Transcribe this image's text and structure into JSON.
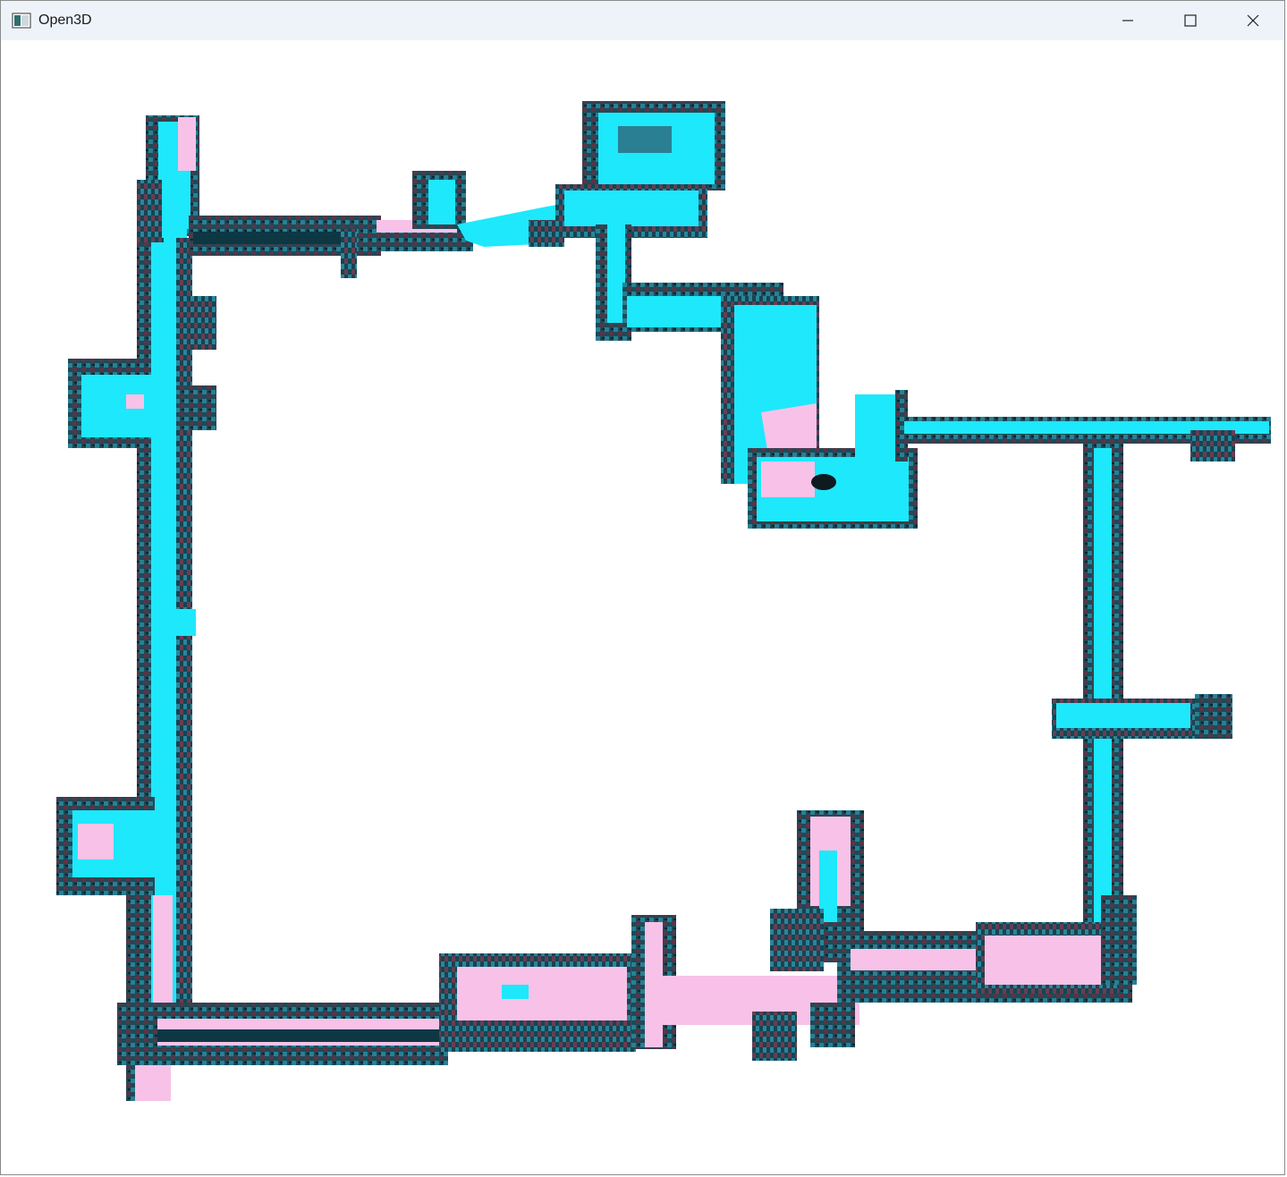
{
  "window": {
    "title": "Open3D",
    "app_icon": "open3d-window-icon",
    "controls": {
      "minimize_icon": "minimize-icon",
      "maximize_icon": "maximize-icon",
      "close_icon": "close-icon"
    }
  },
  "scene": {
    "background": "#ffffff",
    "colors": {
      "cyan": "#1ee8fb",
      "pink": "#f8c2e8",
      "wall_dark": "#0e3744",
      "wall_mauve": "#5b3447",
      "wall_teal": "#2a7f93"
    }
  }
}
